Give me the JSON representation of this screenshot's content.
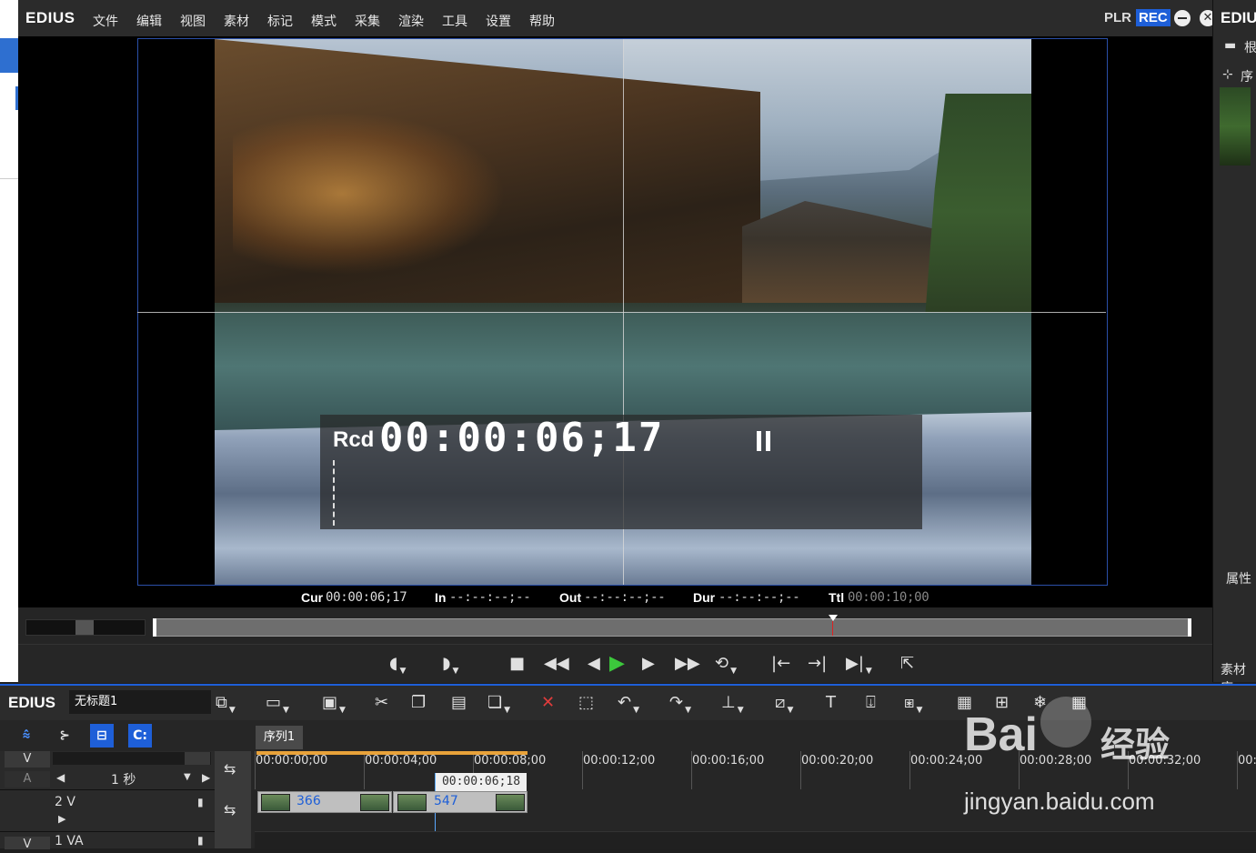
{
  "app": {
    "logo": "EDIUS"
  },
  "menu": [
    "文件",
    "编辑",
    "视图",
    "素材",
    "标记",
    "模式",
    "采集",
    "渲染",
    "工具",
    "设置",
    "帮助"
  ],
  "window_controls": {
    "plr": "PLR",
    "rec": "REC",
    "close": "✕"
  },
  "monitor": {
    "rcd_label": "Rcd",
    "timecode": "00:00:06;17",
    "cur_label": "Cur",
    "cur_value": "00:00:06;17",
    "in_label": "In",
    "in_value": "--:--:--;--",
    "out_label": "Out",
    "out_value": "--:--:--;--",
    "dur_label": "Dur",
    "dur_value": "--:--:--;--",
    "ttl_label": "Ttl",
    "ttl_value": "00:00:10;00",
    "scrub_position": 0.653
  },
  "transport_icons": [
    "set-in-icon",
    "set-out-icon",
    "stop-icon",
    "rewind-icon",
    "step-back-icon",
    "play-icon",
    "step-forward-icon",
    "fast-forward-icon",
    "loop-icon",
    "in-point-icon",
    "out-point-icon",
    "next-icon",
    "export-icon"
  ],
  "right_panel": {
    "logo": "EDIU",
    "tab1": "根",
    "tab2": "序",
    "properties": "属性",
    "library": "素材库"
  },
  "timeline": {
    "logo": "EDIUS",
    "project": "无标题1",
    "sequence_tab": "序列1",
    "track_v_label": "V",
    "track_a_label": "A",
    "zoom_value": "1 秒",
    "track_2v": "2 V",
    "track_1va": "1 VA",
    "track_1va_tag": "V",
    "ruler": [
      "00:00:00;00",
      "00:00:04;00",
      "00:00:08;00",
      "00:00:12;00",
      "00:00:16;00",
      "00:00:20;00",
      "00:00:24;00",
      "00:00:28;00",
      "00:00:32;00",
      "00:"
    ],
    "playhead_tc": "00:00:06;18",
    "clips": [
      {
        "name": "366"
      },
      {
        "name": "547"
      }
    ]
  },
  "watermark": {
    "brand": "Bai",
    "brand2": "经验",
    "url": "jingyan.baidu.com"
  }
}
